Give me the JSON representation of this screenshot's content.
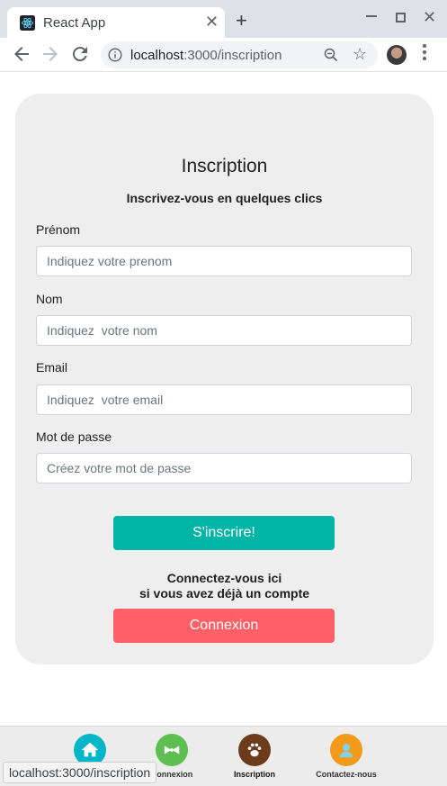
{
  "browser": {
    "tab_title": "React App",
    "url_host": "localhost",
    "url_path": ":3000/inscription",
    "status_url": "localhost:3000/inscription"
  },
  "form": {
    "title": "Inscription",
    "subtitle": "Inscrivez-vous en quelques clics",
    "fields": [
      {
        "label": "Prénom",
        "placeholder": "Indiquez votre prenom"
      },
      {
        "label": "Nom",
        "placeholder": "Indiquez  votre nom"
      },
      {
        "label": "Email",
        "placeholder": "Indiquez  votre email"
      },
      {
        "label": "Mot de passe",
        "placeholder": "Créez votre mot de passe"
      }
    ],
    "signup_label": "S'inscrire!",
    "login_note_line1": "Connectez-vous ici",
    "login_note_line2": "si vous avez déjà un compte",
    "login_label": "Connexion"
  },
  "bottom_nav": {
    "items": [
      {
        "label": "",
        "icon": "home-icon",
        "color": "#00b6c7"
      },
      {
        "label": "Connexion",
        "icon": "bowtie-icon",
        "color": "#5cbf4f"
      },
      {
        "label": "Inscription",
        "icon": "paw-icon",
        "color": "#6b3b1c"
      },
      {
        "label": "Contactez-nous",
        "icon": "support-agent-icon",
        "color": "#f39a1a"
      }
    ]
  },
  "colors": {
    "signup_button": "#00b5a5",
    "login_button": "#ff6068",
    "card_background": "#eeeeef"
  }
}
